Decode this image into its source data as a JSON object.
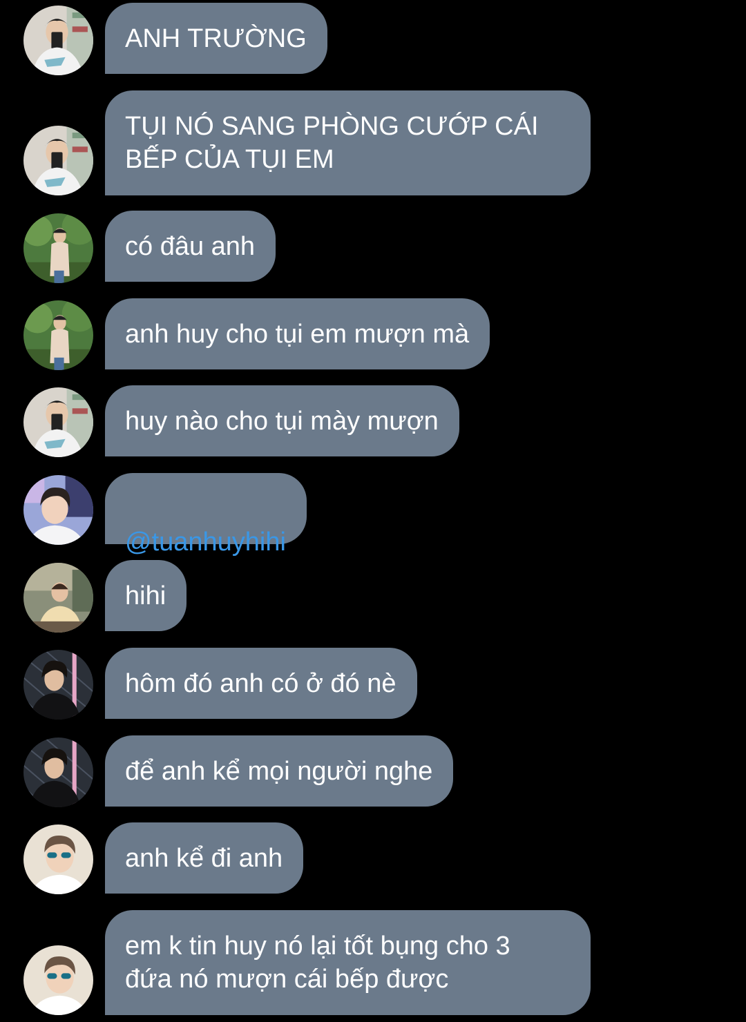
{
  "messages": [
    {
      "text": "ANH TRƯỜNG",
      "avatar": "avatar-a"
    },
    {
      "text": "TỤI NÓ SANG PHÒNG CƯỚP CÁI\nBẾP CỦA TỤI EM",
      "avatar": "avatar-a"
    },
    {
      "text": "có đâu anh",
      "avatar": "avatar-b"
    },
    {
      "text": "anh huy cho tụi em mượn mà",
      "avatar": "avatar-b"
    },
    {
      "text": "huy nào cho tụi mày mượn",
      "avatar": "avatar-a"
    },
    {
      "text": "@tuanhuyhihi",
      "avatar": "avatar-c",
      "mention": true
    },
    {
      "text": "hihi",
      "avatar": "avatar-d"
    },
    {
      "text": "hôm đó anh có ở đó nè",
      "avatar": "avatar-e"
    },
    {
      "text": "để anh kể mọi người nghe",
      "avatar": "avatar-e"
    },
    {
      "text": "anh kể đi anh",
      "avatar": "avatar-f"
    },
    {
      "text": "em k tin huy nó lại tốt bụng cho 3\nđứa nó mượn cái bếp được",
      "avatar": "avatar-f"
    }
  ],
  "colors": {
    "background": "#000000",
    "bubble": "#6b7a8b",
    "text": "#ffffff",
    "mention": "#3a97e6"
  }
}
